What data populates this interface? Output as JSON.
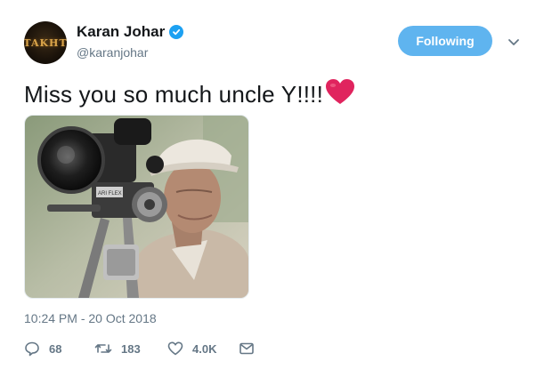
{
  "author": {
    "avatar_text": "TAKHT",
    "display_name": "Karan Johar",
    "handle": "@karanjohar",
    "verified": true
  },
  "follow_button": {
    "label": "Following"
  },
  "tweet": {
    "text": "Miss you so much uncle Y!!!!",
    "emoji": "heart",
    "timestamp": "10:24 PM - 20 Oct 2018"
  },
  "actions": {
    "replies": "68",
    "retweets": "183",
    "likes": "4.0K"
  },
  "colors": {
    "accent": "#1da1f2",
    "follow_button_bg": "#5fb4ef",
    "heart": "#e0245e",
    "muted_text": "#657786"
  },
  "icons": [
    "verified-badge-icon",
    "chevron-down-icon",
    "heart-emoji-icon",
    "reply-icon",
    "retweet-icon",
    "like-icon",
    "direct-message-icon"
  ]
}
